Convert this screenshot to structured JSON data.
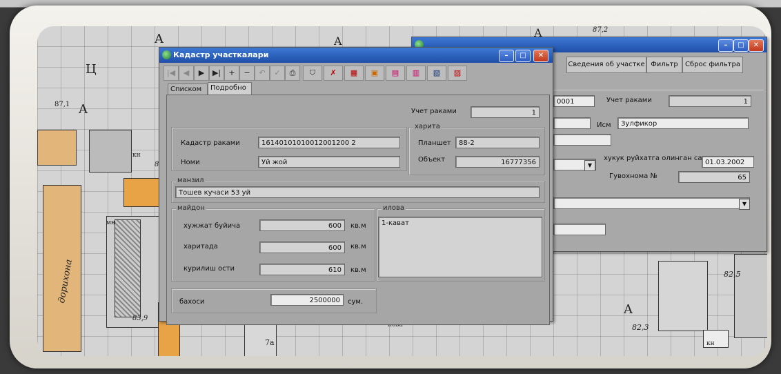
{
  "front_window": {
    "title": "Кадастр участкалари",
    "tabs": [
      "Списком",
      "Подробно"
    ],
    "uchet_label": "Учет раками",
    "uchet_value": "1",
    "karta_group": "харита",
    "kadastr_label": "Кадастр раками",
    "kadastr_value": "16140101010012001200 2",
    "nomi_label": "Номи",
    "nomi_value": "Уй жой",
    "planshet_label": "Планшет",
    "planshet_value": "88-2",
    "obekt_label": "Объект",
    "obekt_value": "16777356",
    "manzil_group": "манзил",
    "manzil_value": "Тошев кучаси 53 уй",
    "maydon_group": "майдон",
    "maydon_rows": [
      {
        "label": "хужжат буйича",
        "value": "600",
        "unit": "кв.м"
      },
      {
        "label": "харитада",
        "value": "600",
        "unit": "кв.м"
      },
      {
        "label": "курилиш ости",
        "value": "610",
        "unit": "кв.м"
      }
    ],
    "ilova_group": "илова",
    "ilova_value": "1-кават",
    "bahosi_label": "бахоси",
    "bahosi_value": "2500000",
    "bahosi_unit": "сум."
  },
  "back_window": {
    "buttons": [
      "Сведения об участке",
      "Фильтр",
      "Сброс фильтра"
    ],
    "field1_value": "0001",
    "uchet_label": "Учет раками",
    "uchet_value": "1",
    "ism_label": "Исм",
    "ism_value": "Зулфикор",
    "date_label": "хукук руйхатга олинган сана",
    "date_value": "01.03.2002",
    "guvohnoma_label": "Гувохнома №",
    "guvohnoma_value": "65"
  },
  "map_labels": [
    "A",
    "Ц",
    "A",
    "A",
    "A",
    "A",
    "87,1",
    "87,2",
    "82,5",
    "82,3",
    "дорихона",
    "кн",
    "мн",
    "7а",
    "85",
    "83,9",
    "нова",
    "кн"
  ],
  "colors": {
    "title": "#1f4fa8",
    "panel": "#a6a6a6",
    "map_building": "#e8a347",
    "map_bg": "#d4d4d4"
  }
}
